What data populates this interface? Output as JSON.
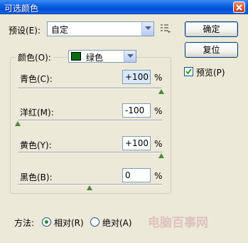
{
  "window": {
    "title": "可选颜色"
  },
  "preset": {
    "label": "预设(E):",
    "value": "自定",
    "menu_icon": "list-options-icon"
  },
  "buttons": {
    "ok": "确定",
    "reset": "复位"
  },
  "preview": {
    "label": "预览(P)",
    "checked": true
  },
  "colors": {
    "label": "颜色(O):",
    "value": "绿色",
    "swatch": "#0c6b0c"
  },
  "sliders": [
    {
      "label": "青色(C):",
      "value": "+100",
      "unit": "%"
    },
    {
      "label": "洋红(M):",
      "value": "-100",
      "unit": "%"
    },
    {
      "label": "黄色(Y):",
      "value": "+100",
      "unit": "%"
    },
    {
      "label": "黑色(B):",
      "value": "0",
      "unit": "%"
    }
  ],
  "method": {
    "label": "方法:",
    "options": [
      "相对(R)",
      "绝对(A)"
    ],
    "selected": "相对(R)"
  },
  "watermark": "电脑百事网"
}
